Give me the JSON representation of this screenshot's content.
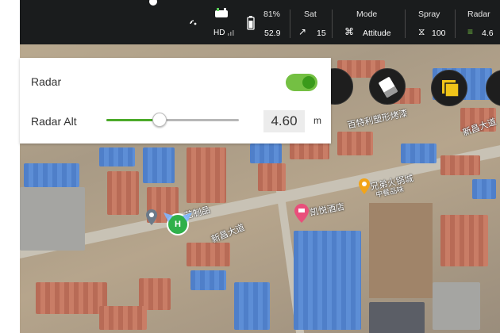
{
  "status_bar": {
    "hd_label": "HD",
    "battery_percent": "81%",
    "battery_voltage": "52.9",
    "sat": {
      "title": "Sat",
      "value": "15"
    },
    "mode": {
      "title": "Mode",
      "value": "Attitude"
    },
    "spray": {
      "title": "Spray",
      "value": "100"
    },
    "radar": {
      "title": "Radar",
      "value": "4.6"
    }
  },
  "radar_panel": {
    "radar_label": "Radar",
    "radar_enabled": true,
    "radar_alt_label": "Radar Alt",
    "slider_fraction": 0.4,
    "alt_value": "4.60",
    "alt_unit": "m"
  },
  "map": {
    "labels": [
      {
        "id": "label-1",
        "text": "百特利塑形烤漆"
      },
      {
        "id": "label-2",
        "text": "新昌大道"
      },
      {
        "id": "label-3",
        "text": "兄弟火锅城"
      },
      {
        "id": "label-4",
        "text": "中餐品味"
      },
      {
        "id": "label-5",
        "text": "凯悦酒店"
      },
      {
        "id": "label-6",
        "text": "新昌大道"
      },
      {
        "id": "label-7",
        "text": "艺制品"
      }
    ],
    "home_marker": "H"
  },
  "colors": {
    "accent_green": "#74c043",
    "status_bar_bg": "#1a1c1d"
  }
}
